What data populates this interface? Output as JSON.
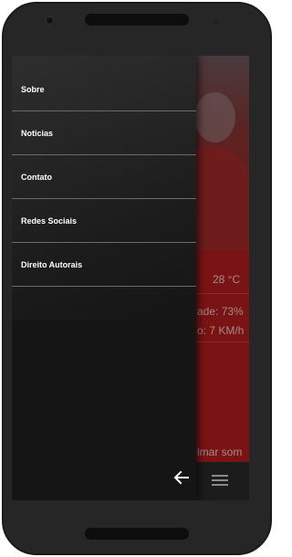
{
  "drawer": {
    "items": [
      {
        "label": "Sobre"
      },
      {
        "label": "Noticias"
      },
      {
        "label": "Contato"
      },
      {
        "label": "Redes Sociais"
      },
      {
        "label": "Direito Autorais"
      }
    ]
  },
  "app": {
    "temperature": "28 °C",
    "humidity": "ade: 73%",
    "wind": "o: 7 KM/h",
    "sound": "lmar som"
  },
  "icons": {
    "back": "arrow-left-icon",
    "menu": "hamburger-menu-icon"
  },
  "colors": {
    "app_background": "#7a1414",
    "drawer_background": "#151515",
    "drawer_text": "#ffffff"
  }
}
